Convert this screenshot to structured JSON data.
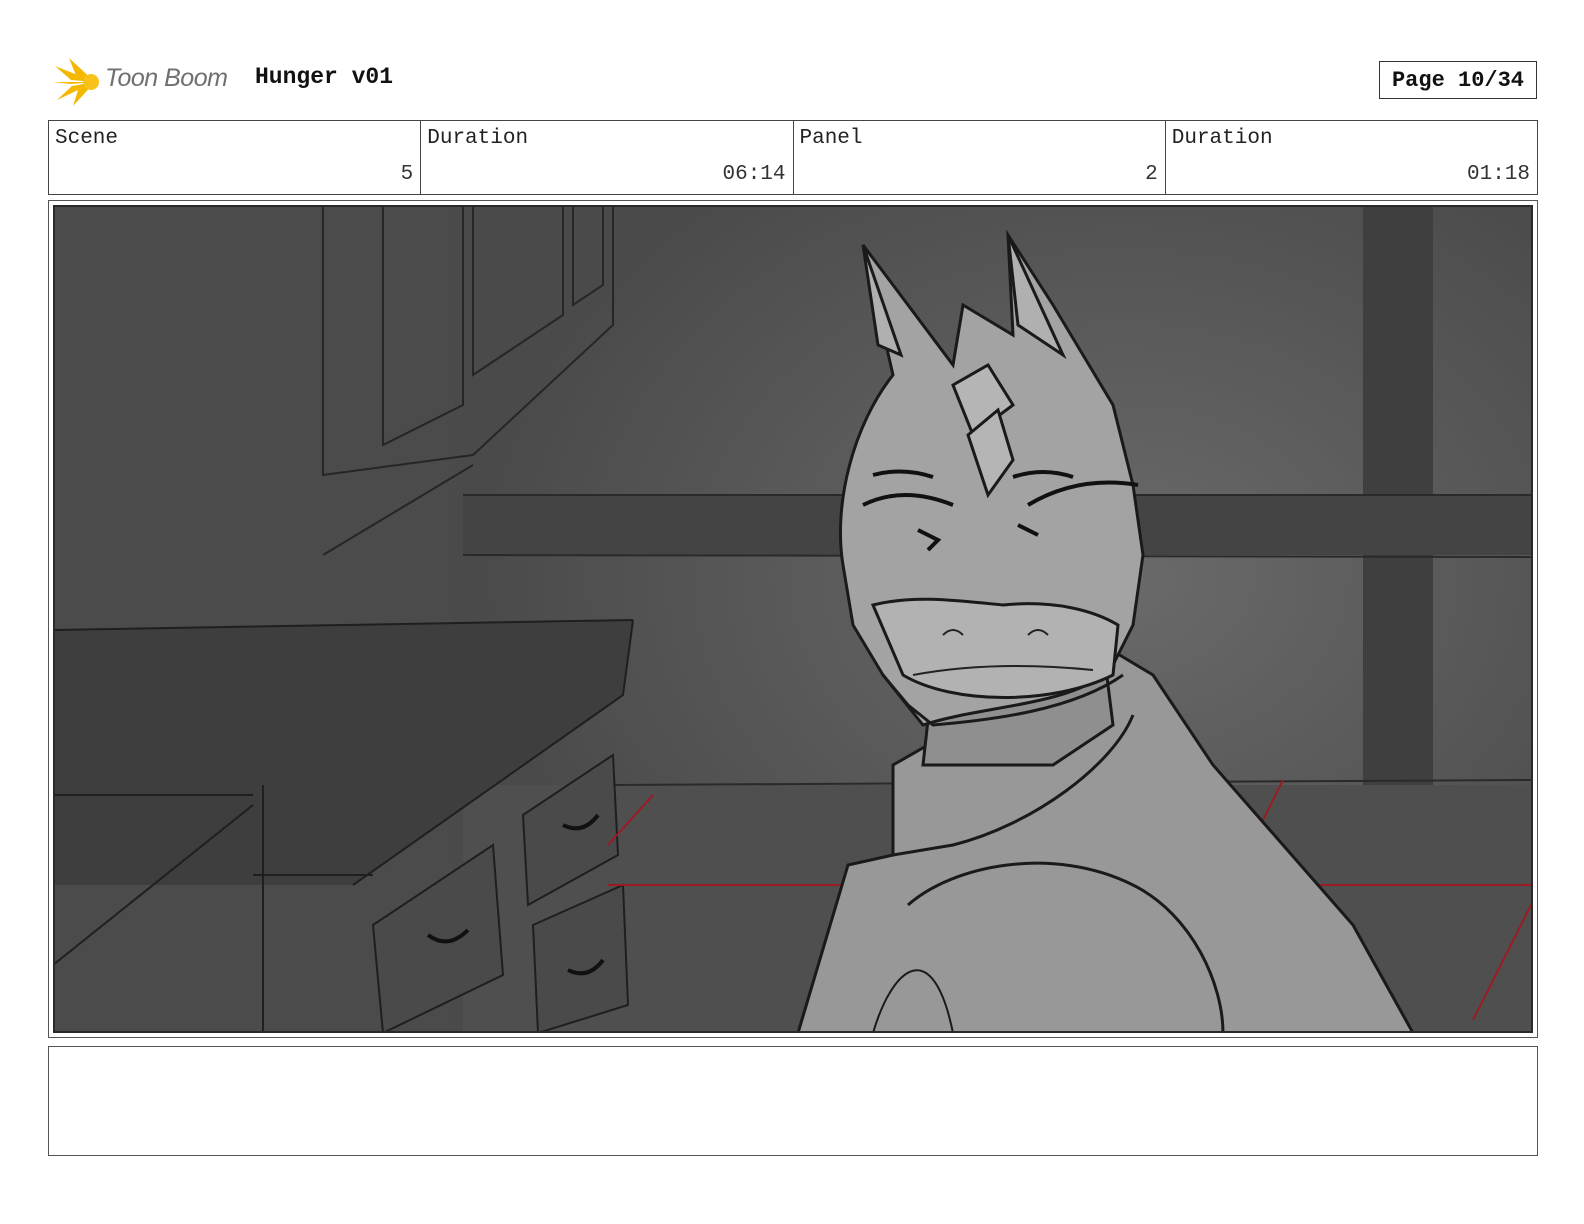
{
  "header": {
    "logo_text": "Toon Boom",
    "project_title": "Hunger v01",
    "page_label": "Page 10/34"
  },
  "info": {
    "scene_label": "Scene",
    "scene_value": "5",
    "scene_duration_label": "Duration",
    "scene_duration_value": "06:14",
    "panel_label": "Panel",
    "panel_value": "2",
    "panel_duration_label": "Duration",
    "panel_duration_value": "01:18"
  },
  "notes": {
    "text": ""
  }
}
